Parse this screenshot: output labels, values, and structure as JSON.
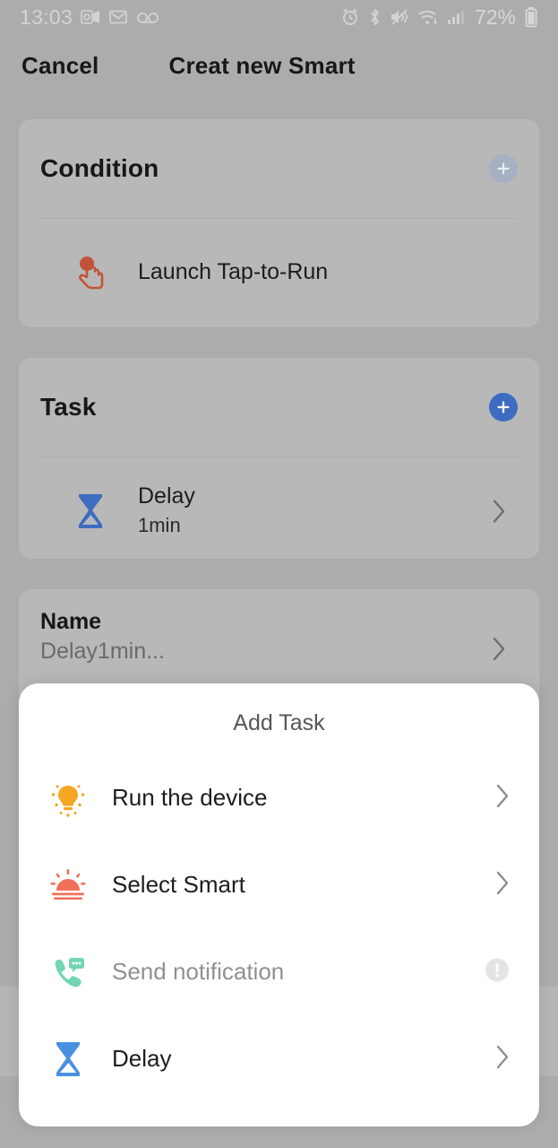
{
  "statusbar": {
    "time": "13:03",
    "left_icons": [
      "outlook-icon",
      "mail-icon",
      "voicemail-icon"
    ],
    "right_icons": [
      "alarm-icon",
      "bluetooth-icon",
      "mute-vibrate-icon",
      "wifi-icon",
      "cellular-signal-icon"
    ],
    "battery_percent": "72%",
    "battery_icon": "battery-icon"
  },
  "navbar": {
    "cancel_label": "Cancel",
    "title": "Creat new Smart"
  },
  "condition_card": {
    "title": "Condition",
    "add_button_icon": "plus-icon",
    "add_button_enabled": false,
    "rows": [
      {
        "icon": "tap-to-run-icon",
        "title": "Launch Tap-to-Run"
      }
    ]
  },
  "task_card": {
    "title": "Task",
    "add_button_icon": "plus-icon",
    "add_button_enabled": true,
    "rows": [
      {
        "icon": "hourglass-icon",
        "title": "Delay",
        "subtitle": "1min",
        "chevron": "chevron-right-icon"
      }
    ]
  },
  "name_card": {
    "label": "Name",
    "value": "Delay1min...",
    "chevron": "chevron-right-icon"
  },
  "sheet": {
    "title": "Add Task",
    "items": [
      {
        "label": "Run the device",
        "icon": "lightbulb-icon",
        "accessory": "chevron-right-icon",
        "disabled": false
      },
      {
        "label": "Select Smart",
        "icon": "sunrise-icon",
        "accessory": "chevron-right-icon",
        "disabled": false
      },
      {
        "label": "Send notification",
        "icon": "phone-message-icon",
        "accessory": "info-icon",
        "disabled": true
      },
      {
        "label": "Delay",
        "icon": "hourglass-icon",
        "accessory": "chevron-right-icon",
        "disabled": false
      }
    ]
  },
  "colors": {
    "page_bg": "#b0b0b0",
    "card_bg": "#bcbcbc",
    "sheet_bg": "#ffffff",
    "accent_blue": "#3f6fc4",
    "accent_blue_disabled": "#a9b4c6",
    "hourglass_blue": "#4a8fe0",
    "lightbulb_amber": "#f5a623",
    "sunrise_coral": "#f0705a",
    "tap_orange": "#c7553a",
    "mint_green": "#72d6b0",
    "disabled_text": "#8e9194"
  }
}
